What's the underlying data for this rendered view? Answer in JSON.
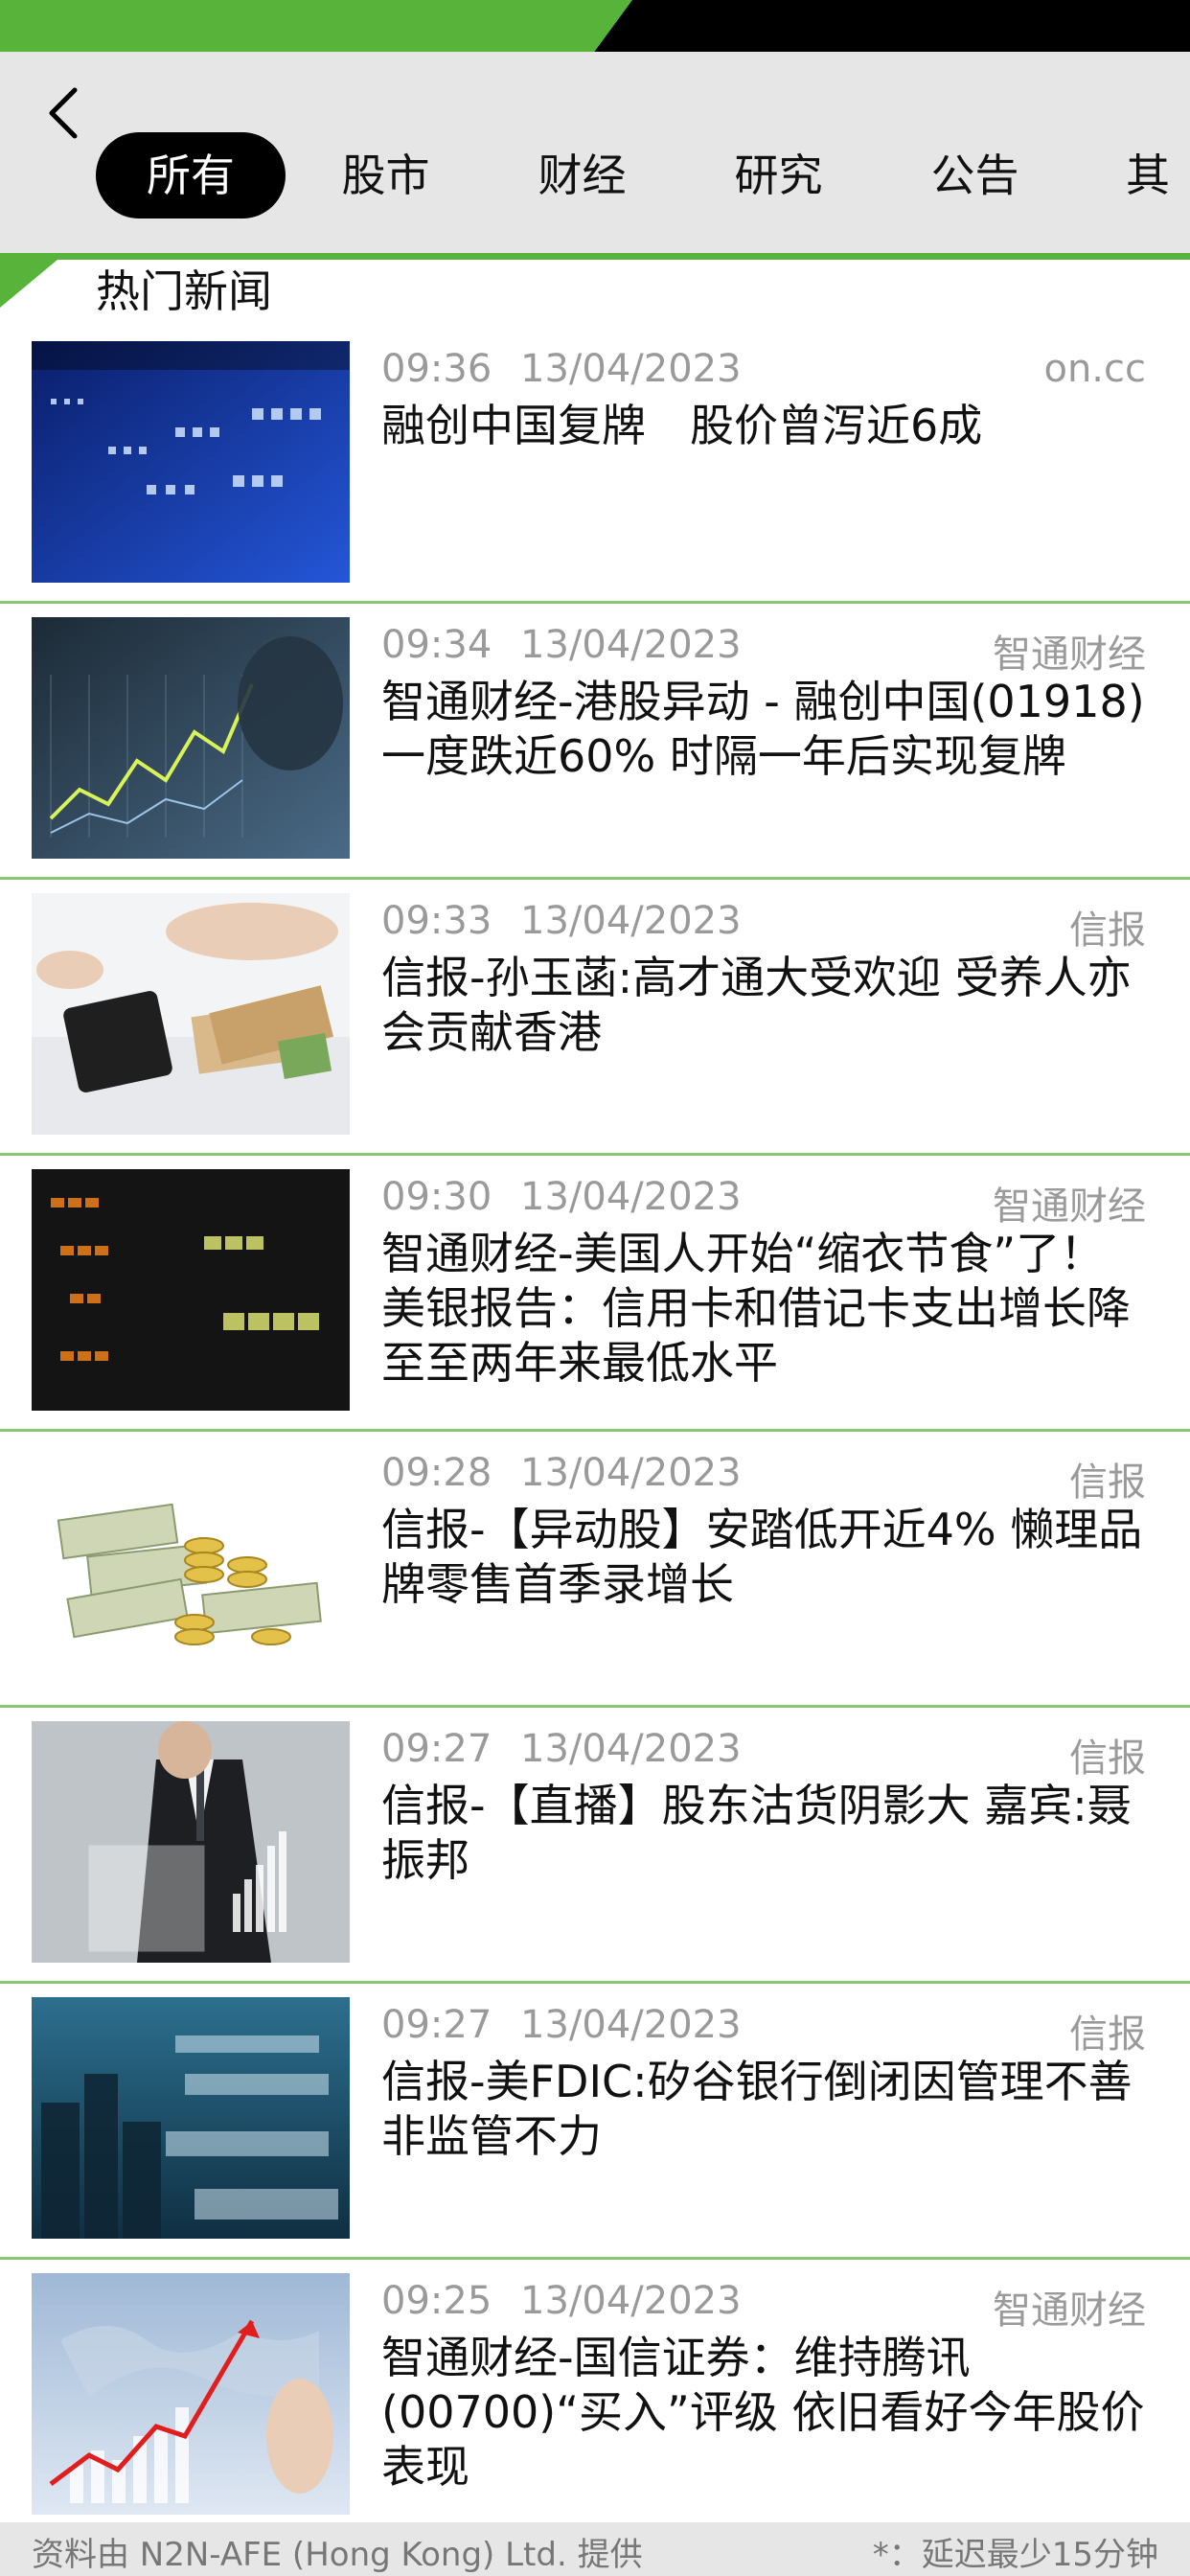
{
  "header": {
    "tabs": [
      "所有",
      "股市",
      "财经",
      "研究",
      "公告",
      "其"
    ],
    "active_tab": "所有"
  },
  "section": {
    "title": "热门新闻"
  },
  "news": [
    {
      "time": "09:36",
      "date": "13/04/2023",
      "source": "on.cc",
      "headline": "融创中国复牌　股价曾泻近6成",
      "thumb": "stock-board-image"
    },
    {
      "time": "09:34",
      "date": "13/04/2023",
      "source": "智通财经",
      "headline": "智通财经-港股异动 - 融创中国(01918)一度跌近60% 时隔一年后实现复牌",
      "thumb": "touch-chart-image"
    },
    {
      "time": "09:33",
      "date": "13/04/2023",
      "source": "信报",
      "headline": "信报-孙玉菡:高才通大受欢迎 受养人亦会贡献香港",
      "thumb": "calculator-money-image"
    },
    {
      "time": "09:30",
      "date": "13/04/2023",
      "source": "智通财经",
      "headline": "智通财经-美国人开始“缩衣节食”了！美银报告：信用卡和借记卡支出增长降至至两年来最低水平",
      "thumb": "ticker-board-image"
    },
    {
      "time": "09:28",
      "date": "13/04/2023",
      "source": "信报",
      "headline": "信报-【异动股】安踏低开近4% 懒理品牌零售首季录增长",
      "thumb": "cash-coins-image"
    },
    {
      "time": "09:27",
      "date": "13/04/2023",
      "source": "信报",
      "headline": "信报-【直播】股东沽货阴影大 嘉宾:聂振邦",
      "thumb": "businessman-chart-image"
    },
    {
      "time": "09:27",
      "date": "13/04/2023",
      "source": "信报",
      "headline": "信报-美FDIC:矽谷银行倒闭因管理不善非监管不力",
      "thumb": "city-numbers-image"
    },
    {
      "time": "09:25",
      "date": "13/04/2023",
      "source": "智通财经",
      "headline": "智通财经-国信证券：维持腾讯(00700)“买入”评级 依旧看好今年股价表现",
      "thumb": "growth-arrow-image"
    }
  ],
  "footer": {
    "left": "资料由 N2N-AFE (Hong Kong) Ltd. 提供",
    "right": "*：延迟最少15分钟"
  },
  "colors": {
    "accent": "#58b33a",
    "divider": "#8cc471",
    "header_bg": "#e6e6e6"
  }
}
